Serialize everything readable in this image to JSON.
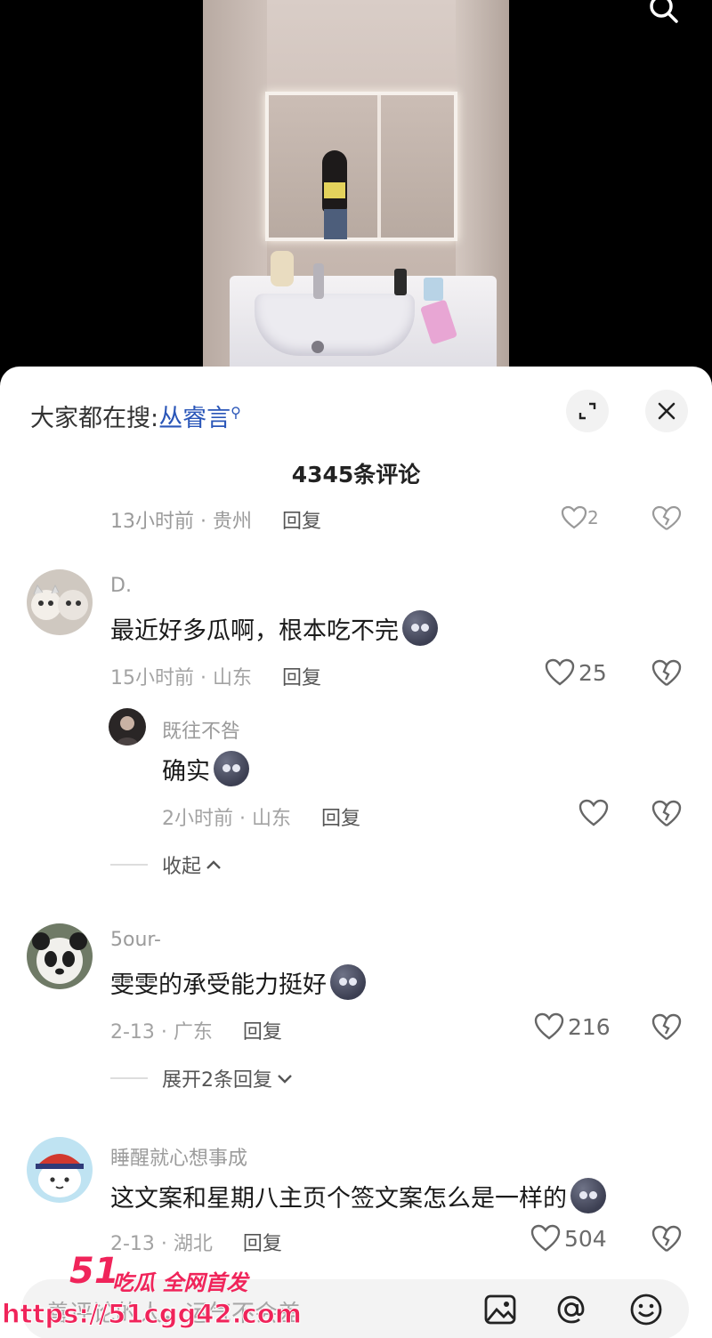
{
  "suggest": {
    "prefix": "大家都在搜:",
    "keyword": "丛睿言"
  },
  "comment_count": "4345条评论",
  "partial_comment": {
    "meta": "13小时前 · 贵州",
    "reply": "回复",
    "likes": "2"
  },
  "comments": [
    {
      "user": "D.",
      "text": "最近好多瓜啊，根本吃不完",
      "meta": "15小时前 · 山东",
      "reply": "回复",
      "likes": "25"
    },
    {
      "user": "既往不咎",
      "text": "确实",
      "meta": "2小时前 · 山东",
      "reply": "回复",
      "likes": ""
    },
    {
      "user": "5our-",
      "text": "雯雯的承受能力挺好",
      "meta": "2-13 · 广东",
      "reply": "回复",
      "likes": "216"
    },
    {
      "user": "睡醒就心想事成",
      "text": "这文案和星期八主页个签文案怎么是一样的",
      "meta": "2-13 · 湖北",
      "reply": "回复",
      "likes": "504"
    }
  ],
  "collapse_label": "收起",
  "expand_replies_label": "展开2条回复",
  "input": {
    "placeholder": "善评论的人，运气不会差"
  },
  "watermark": {
    "brand": "51",
    "tagline": "吃瓜 全网首发",
    "url": "https://51cgg42.com"
  },
  "colors": {
    "accent": "#2a56b8",
    "watermark": "#f0245a"
  }
}
